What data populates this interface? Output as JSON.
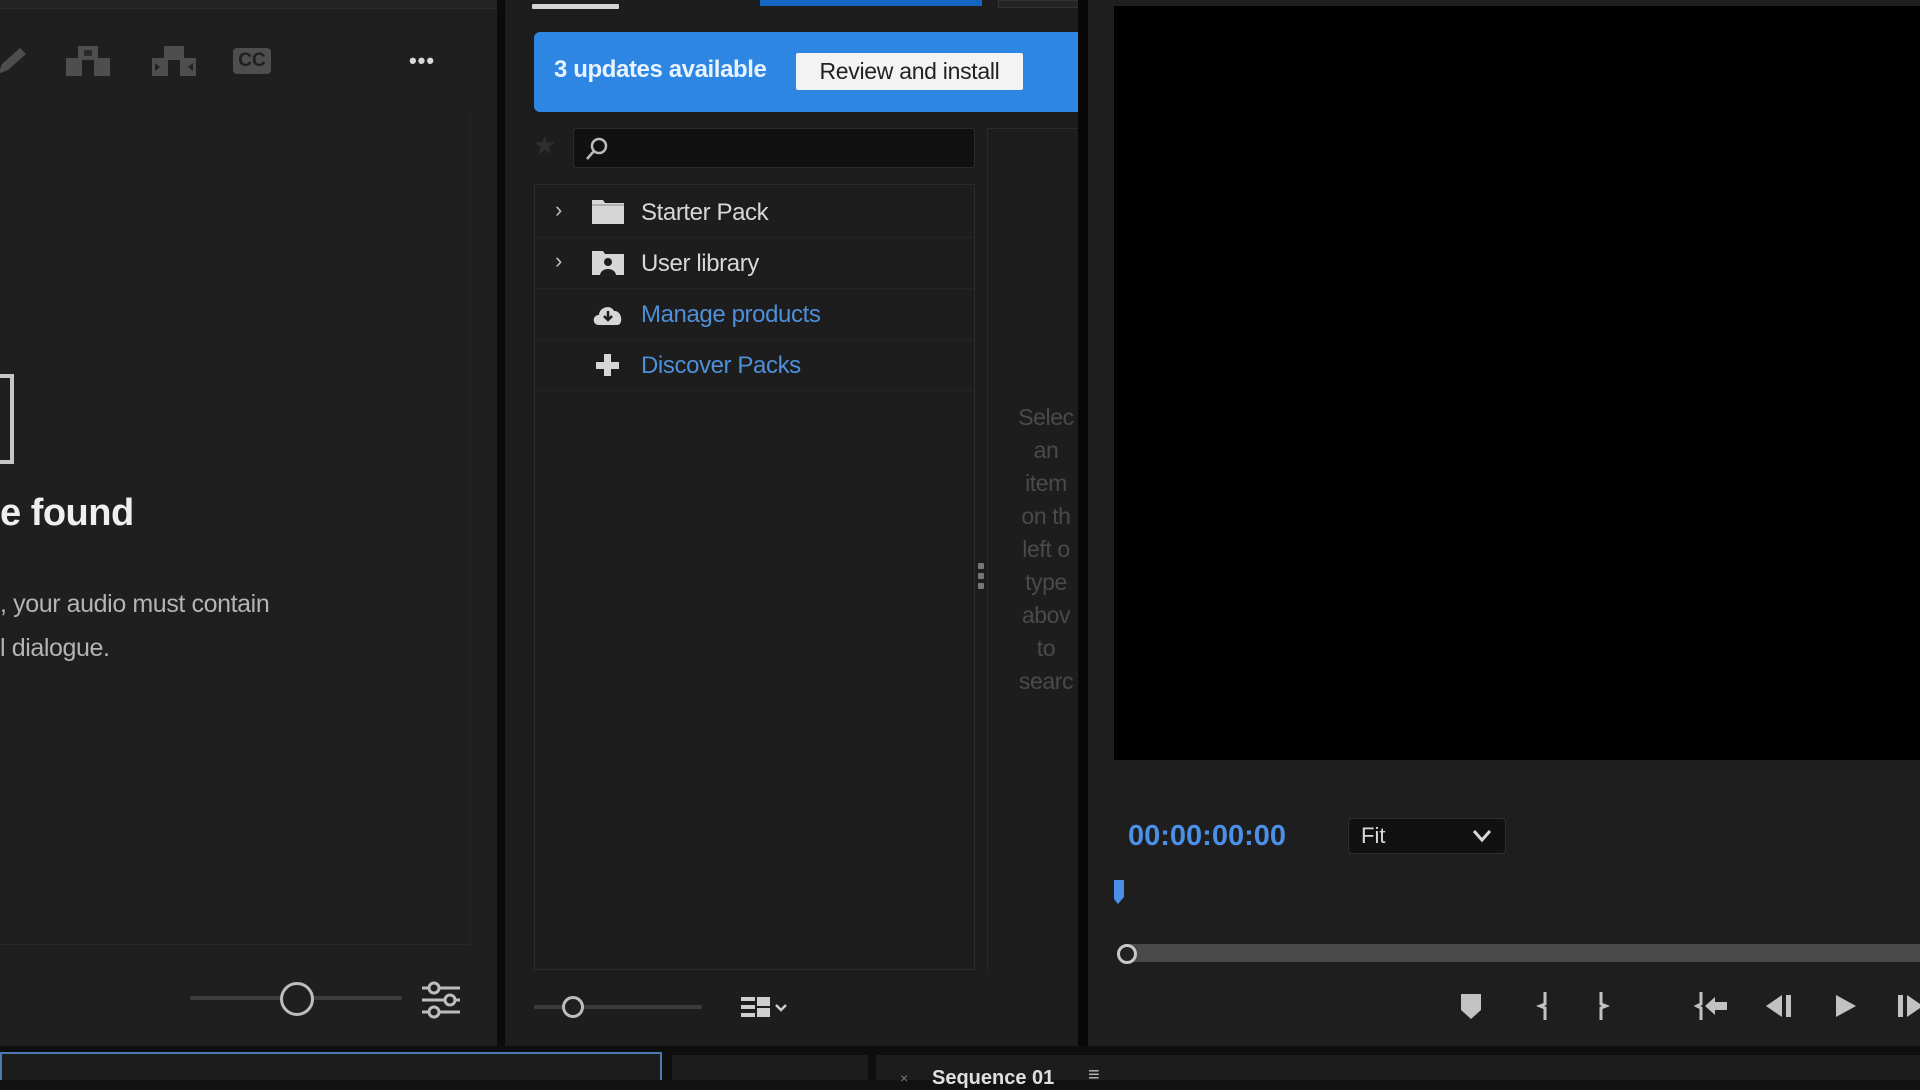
{
  "left_panel": {
    "toolbar": [
      {
        "name": "pencil-icon"
      },
      {
        "name": "auto-detect-icon"
      },
      {
        "name": "speaker-tag-icon"
      },
      {
        "name": "captions-icon",
        "label": "CC"
      },
      {
        "name": "more-options-icon",
        "label": "•••"
      }
    ],
    "empty_state": {
      "title": "e found",
      "desc_line1": ", your audio must contain",
      "desc_line2": "l dialogue."
    },
    "zoom_slider_value": 0.5
  },
  "middle_panel": {
    "update_banner": {
      "message": "3 updates available",
      "button_label": "Review and install",
      "color": "#2e86e3"
    },
    "search": {
      "placeholder": "",
      "value": ""
    },
    "tree": [
      {
        "label": "Starter Pack",
        "icon": "folder-icon",
        "expandable": true,
        "style": "white"
      },
      {
        "label": "User library",
        "icon": "user-folder-icon",
        "expandable": true,
        "style": "white"
      },
      {
        "label": "Manage products",
        "icon": "cloud-download-icon",
        "expandable": false,
        "style": "blue"
      },
      {
        "label": "Discover Packs",
        "icon": "plus-icon",
        "expandable": false,
        "style": "blue"
      }
    ],
    "side_hint_lines": [
      "Selec",
      "an",
      "item",
      "on th",
      "left o",
      "type",
      "abov",
      "to",
      "searc"
    ],
    "thumb_size_slider_value": 0.12
  },
  "monitor": {
    "timecode": "00:00:00:00",
    "zoom_select": "Fit",
    "accent": "#4b8fe6",
    "playhead_position": 0.0,
    "transport": [
      {
        "name": "add-marker-icon"
      },
      {
        "name": "mark-in-icon"
      },
      {
        "name": "mark-out-icon"
      },
      {
        "name": "go-to-in-icon"
      },
      {
        "name": "step-back-icon"
      },
      {
        "name": "play-icon"
      },
      {
        "name": "step-forward-icon"
      }
    ]
  },
  "bottom_tabs": {
    "sequence_tab": "Sequence 01",
    "close_glyph": "×",
    "menu_glyph": "≡"
  }
}
